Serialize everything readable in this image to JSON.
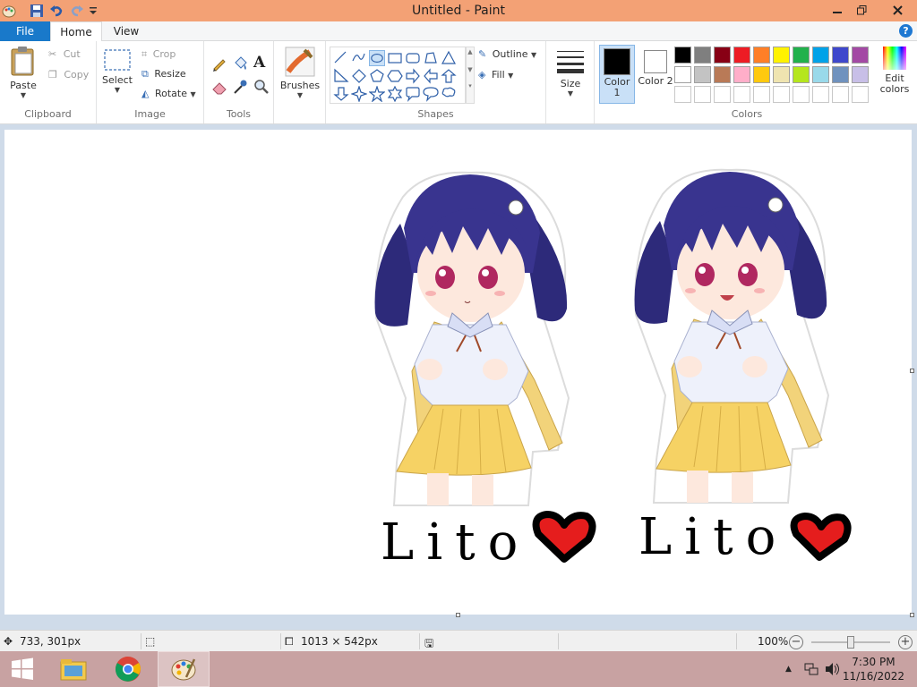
{
  "window": {
    "title": "Untitled - Paint"
  },
  "tabs": {
    "file": "File",
    "home": "Home",
    "view": "View"
  },
  "help_label": "?",
  "clipboard": {
    "paste": "Paste",
    "cut": "Cut",
    "copy": "Copy",
    "label": "Clipboard"
  },
  "image": {
    "select": "Select",
    "crop": "Crop",
    "resize": "Resize",
    "rotate": "Rotate",
    "label": "Image"
  },
  "tools": {
    "label": "Tools",
    "text_glyph": "A"
  },
  "brushes": {
    "label": "Brushes"
  },
  "shapes": {
    "outline": "Outline",
    "fill": "Fill",
    "label": "Shapes"
  },
  "size": {
    "label": "Size"
  },
  "colors": {
    "color1_label": "Color 1",
    "color1_value": "#000000",
    "color2_label": "Color 2",
    "color2_value": "#ffffff",
    "label": "Colors",
    "edit_label": "Edit colors",
    "palette_row1": [
      "#000000",
      "#7f7f7f",
      "#880015",
      "#ed1c24",
      "#ff7f27",
      "#fff200",
      "#22b14c",
      "#00a2e8",
      "#3f48cc",
      "#a349a4"
    ],
    "palette_row2": [
      "#ffffff",
      "#c3c3c3",
      "#b97a57",
      "#ffaec9",
      "#ffc90e",
      "#efe4b0",
      "#b5e61d",
      "#99d9ea",
      "#7092be",
      "#c8bfe7"
    ]
  },
  "canvas": {
    "handwriting_1": "Lito",
    "handwriting_2": "Lito"
  },
  "status": {
    "cursor_pos": "733, 301px",
    "selection_size": "",
    "canvas_size": "1013 × 542px",
    "zoom": "100%"
  },
  "taskbar": {
    "time": "7:30 PM",
    "date": "11/16/2022"
  }
}
